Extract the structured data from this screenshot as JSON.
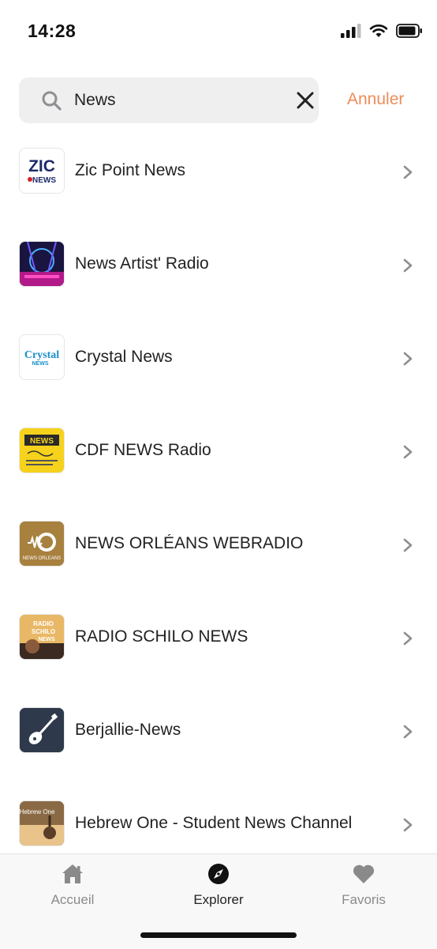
{
  "status_bar": {
    "time": "14:28"
  },
  "search": {
    "query": "News",
    "cancel_label": "Annuler"
  },
  "results": [
    {
      "label": "Zic Point News",
      "logo_text": "ZIC",
      "logo_subtext": "NEWS",
      "logo_bg": "#ffffff"
    },
    {
      "label": "News Artist' Radio",
      "logo_bg": "#1a1440"
    },
    {
      "label": "Crystal News",
      "logo_text": "Crystal",
      "logo_subtext": "NEWS",
      "logo_bg": "#ffffff"
    },
    {
      "label": "CDF NEWS Radio",
      "logo_text": "NEWS",
      "logo_bg": "#f6d21c"
    },
    {
      "label": "NEWS ORLÉANS WEBRADIO",
      "logo_text": "NEWS ORLEANS",
      "logo_bg": "#a8813f"
    },
    {
      "label": "RADIO SCHILO NEWS",
      "logo_text": "RADIO SCHILO NEWS",
      "logo_bg": "#d9a24a"
    },
    {
      "label": "Berjallie-News",
      "logo_bg": "#2e3a4b"
    },
    {
      "label": "Hebrew One - Student News Channel",
      "logo_text": "Hebrew One",
      "logo_bg": "#7a5a3a"
    }
  ],
  "tabs": [
    {
      "label": "Accueil",
      "icon": "home-icon",
      "active": false
    },
    {
      "label": "Explorer",
      "icon": "compass-icon",
      "active": true
    },
    {
      "label": "Favoris",
      "icon": "heart-icon",
      "active": false
    }
  ],
  "colors": {
    "accent": "#ee8d5a",
    "search_bg": "#efefef",
    "chevron": "#8e8e93"
  }
}
